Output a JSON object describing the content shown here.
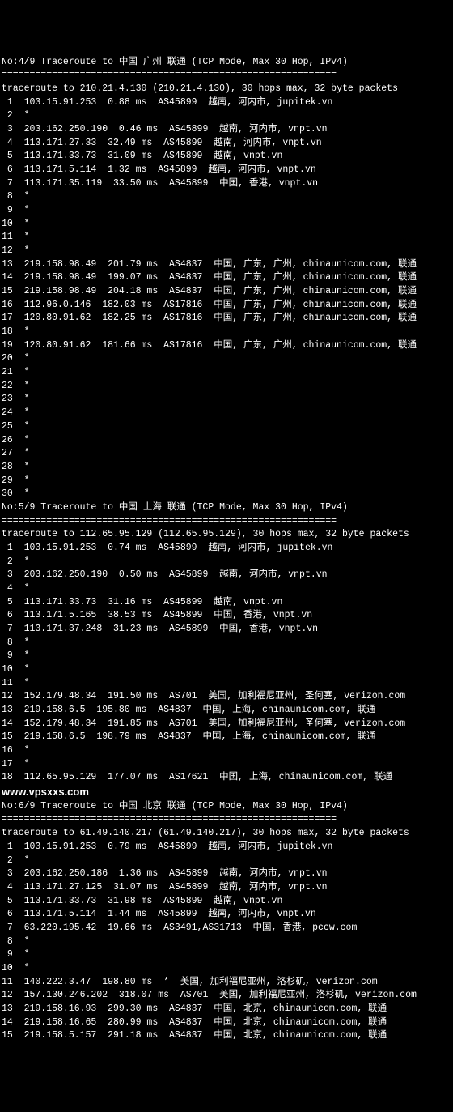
{
  "watermark": "www.vpsxxs.com",
  "traces": [
    {
      "header": "No:4/9 Traceroute to 中国 广州 联通 (TCP Mode, Max 30 Hop, IPv4)",
      "divider": "============================================================",
      "summary": "traceroute to 210.21.4.130 (210.21.4.130), 30 hops max, 32 byte packets",
      "hops": [
        " 1  103.15.91.253  0.88 ms  AS45899  越南, 河内市, jupitek.vn",
        " 2  *",
        " 3  203.162.250.190  0.46 ms  AS45899  越南, 河内市, vnpt.vn",
        " 4  113.171.27.33  32.49 ms  AS45899  越南, 河内市, vnpt.vn",
        " 5  113.171.33.73  31.09 ms  AS45899  越南, vnpt.vn",
        " 6  113.171.5.114  1.32 ms  AS45899  越南, 河内市, vnpt.vn",
        " 7  113.171.35.119  33.50 ms  AS45899  中国, 香港, vnpt.vn",
        " 8  *",
        " 9  *",
        "10  *",
        "11  *",
        "12  *",
        "13  219.158.98.49  201.79 ms  AS4837  中国, 广东, 广州, chinaunicom.com, 联通",
        "14  219.158.98.49  199.07 ms  AS4837  中国, 广东, 广州, chinaunicom.com, 联通",
        "15  219.158.98.49  204.18 ms  AS4837  中国, 广东, 广州, chinaunicom.com, 联通",
        "16  112.96.0.146  182.03 ms  AS17816  中国, 广东, 广州, chinaunicom.com, 联通",
        "17  120.80.91.62  182.25 ms  AS17816  中国, 广东, 广州, chinaunicom.com, 联通",
        "18  *",
        "19  120.80.91.62  181.66 ms  AS17816  中国, 广东, 广州, chinaunicom.com, 联通",
        "20  *",
        "21  *",
        "22  *",
        "23  *",
        "24  *",
        "25  *",
        "26  *",
        "27  *",
        "28  *",
        "29  *",
        "30  *"
      ]
    },
    {
      "header": "No:5/9 Traceroute to 中国 上海 联通 (TCP Mode, Max 30 Hop, IPv4)",
      "divider": "============================================================",
      "summary": "traceroute to 112.65.95.129 (112.65.95.129), 30 hops max, 32 byte packets",
      "hops": [
        " 1  103.15.91.253  0.74 ms  AS45899  越南, 河内市, jupitek.vn",
        " 2  *",
        " 3  203.162.250.190  0.50 ms  AS45899  越南, 河内市, vnpt.vn",
        " 4  *",
        " 5  113.171.33.73  31.16 ms  AS45899  越南, vnpt.vn",
        " 6  113.171.5.165  38.53 ms  AS45899  中国, 香港, vnpt.vn",
        " 7  113.171.37.248  31.23 ms  AS45899  中国, 香港, vnpt.vn",
        " 8  *",
        " 9  *",
        "10  *",
        "11  *",
        "12  152.179.48.34  191.50 ms  AS701  美国, 加利福尼亚州, 圣何塞, verizon.com",
        "13  219.158.6.5  195.80 ms  AS4837  中国, 上海, chinaunicom.com, 联通",
        "14  152.179.48.34  191.85 ms  AS701  美国, 加利福尼亚州, 圣何塞, verizon.com",
        "15  219.158.6.5  198.79 ms  AS4837  中国, 上海, chinaunicom.com, 联通",
        "16  *",
        "17  *",
        "18  112.65.95.129  177.07 ms  AS17621  中国, 上海, chinaunicom.com, 联通"
      ]
    },
    {
      "header": "No:6/9 Traceroute to 中国 北京 联通 (TCP Mode, Max 30 Hop, IPv4)",
      "divider": "============================================================",
      "summary": "traceroute to 61.49.140.217 (61.49.140.217), 30 hops max, 32 byte packets",
      "hops": [
        " 1  103.15.91.253  0.79 ms  AS45899  越南, 河内市, jupitek.vn",
        " 2  *",
        " 3  203.162.250.186  1.36 ms  AS45899  越南, 河内市, vnpt.vn",
        " 4  113.171.27.125  31.07 ms  AS45899  越南, 河内市, vnpt.vn",
        " 5  113.171.33.73  31.98 ms  AS45899  越南, vnpt.vn",
        " 6  113.171.5.114  1.44 ms  AS45899  越南, 河内市, vnpt.vn",
        " 7  63.220.195.42  19.66 ms  AS3491,AS31713  中国, 香港, pccw.com",
        " 8  *",
        " 9  *",
        "10  *",
        "11  140.222.3.47  198.80 ms  *  美国, 加利福尼亚州, 洛杉矶, verizon.com",
        "12  157.130.246.202  318.07 ms  AS701  美国, 加利福尼亚州, 洛杉矶, verizon.com",
        "13  219.158.16.93  299.30 ms  AS4837  中国, 北京, chinaunicom.com, 联通",
        "14  219.158.16.65  280.99 ms  AS4837  中国, 北京, chinaunicom.com, 联通",
        "15  219.158.5.157  291.18 ms  AS4837  中国, 北京, chinaunicom.com, 联通"
      ]
    }
  ]
}
